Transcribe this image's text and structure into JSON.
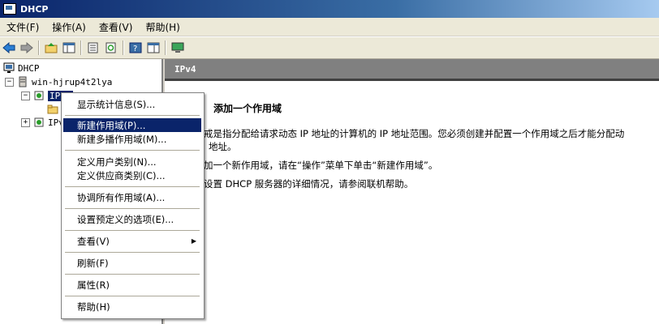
{
  "window": {
    "title": "DHCP"
  },
  "menubar": {
    "items": [
      "文件(F)",
      "操作(A)",
      "查看(V)",
      "帮助(H)"
    ]
  },
  "toolbar": {
    "icons": [
      "back-arrow-icon",
      "forward-arrow-icon",
      "up-folder-icon",
      "show-hide-tree-icon",
      "properties-icon",
      "refresh-icon",
      "help-icon",
      "export-list-icon",
      "monitor-icon"
    ]
  },
  "tree": {
    "root": "DHCP",
    "server": "win-hjrup4t2lya",
    "ipv4": "IPv4",
    "ipv6": "IPv6"
  },
  "right_panel": {
    "header": "IPv4",
    "heading": "添加一个作用域",
    "para1_line1": "戒是指分配给请求动态 IP 地址的计算机的 IP 地址范围。您必须创建并配置一个作用域之后才能分配动",
    "para1_line2": "地址。",
    "para2": "加一个新作用域，请在“操作”菜单下单击“新建作用域”。",
    "para3": "设置 DHCP 服务器的详细情况，请参阅联机帮助。"
  },
  "context_menu": {
    "items": [
      {
        "label": "显示统计信息(S)..."
      },
      {
        "label": "新建作用域(P)...",
        "highlighted": true
      },
      {
        "label": "新建多播作用域(M)..."
      },
      {
        "label": "定义用户类别(N)..."
      },
      {
        "label": "定义供应商类别(C)..."
      },
      {
        "label": "协调所有作用域(A)..."
      },
      {
        "label": "设置预定义的选项(E)..."
      },
      {
        "label": "查看(V)",
        "submenu": true
      },
      {
        "label": "刷新(F)"
      },
      {
        "label": "属性(R)"
      },
      {
        "label": "帮助(H)"
      }
    ]
  },
  "colors": {
    "selection": "#0a246a",
    "header": "#808080"
  }
}
